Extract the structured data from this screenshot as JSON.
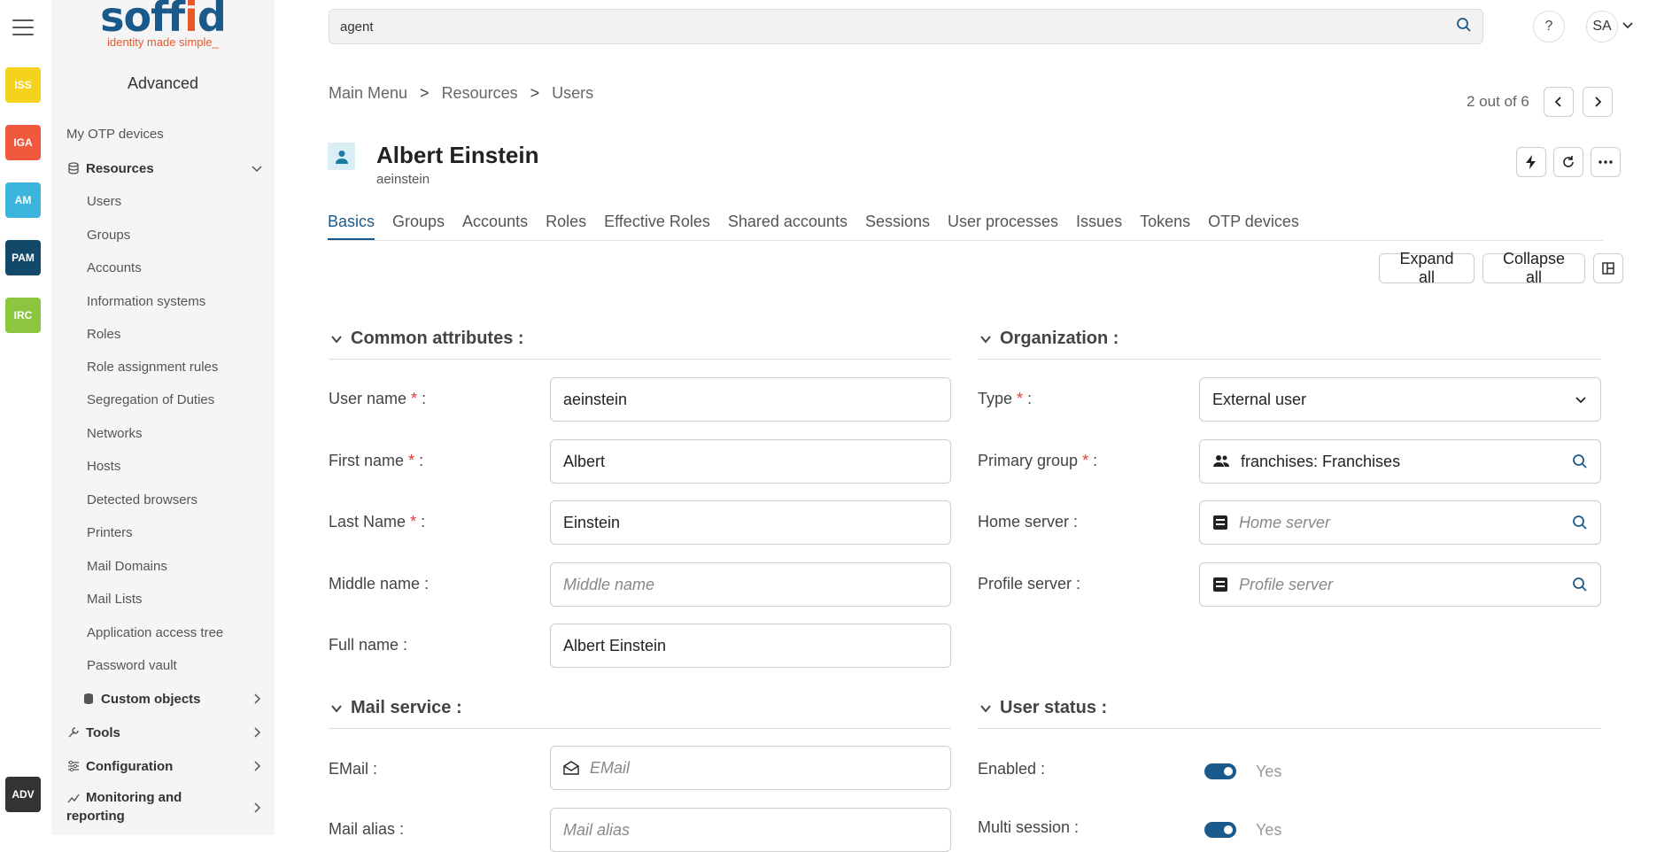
{
  "rail": {
    "items": [
      {
        "label": "ISS",
        "color": "#f5d21b"
      },
      {
        "label": "IGA",
        "color": "#f0593e"
      },
      {
        "label": "AM",
        "color": "#3cb5de"
      },
      {
        "label": "PAM",
        "color": "#12496b"
      },
      {
        "label": "IRC",
        "color": "#8cc63f"
      },
      {
        "label": "ADV",
        "color": "#333333"
      }
    ]
  },
  "logo": {
    "main_a": "soff",
    "main_i": "i",
    "main_b": "d",
    "tagline": "identity made simple_"
  },
  "sidebar": {
    "title": "Advanced",
    "items": [
      {
        "label": "My OTP devices"
      },
      {
        "label": "Resources"
      },
      {
        "label": "Users"
      },
      {
        "label": "Groups"
      },
      {
        "label": "Accounts"
      },
      {
        "label": "Information systems"
      },
      {
        "label": "Roles"
      },
      {
        "label": "Role assignment rules"
      },
      {
        "label": "Segregation of Duties"
      },
      {
        "label": "Networks"
      },
      {
        "label": "Hosts"
      },
      {
        "label": "Detected browsers"
      },
      {
        "label": "Printers"
      },
      {
        "label": "Mail Domains"
      },
      {
        "label": "Mail Lists"
      },
      {
        "label": "Application access tree"
      },
      {
        "label": "Password vault"
      },
      {
        "label": "Custom objects"
      },
      {
        "label": "Tools"
      },
      {
        "label": "Configuration"
      },
      {
        "label": "Monitoring and"
      },
      {
        "label": "reporting"
      }
    ]
  },
  "search": {
    "value": "agent"
  },
  "header": {
    "help": "?",
    "user_initials": "SA"
  },
  "breadcrumb": {
    "items": [
      "Main Menu",
      "Resources",
      "Users"
    ],
    "sep": ">"
  },
  "pager": {
    "text": "2 out of 6"
  },
  "user": {
    "name": "Albert Einstein",
    "login": "aeinstein"
  },
  "tabs": [
    "Basics",
    "Groups",
    "Accounts",
    "Roles",
    "Effective Roles",
    "Shared accounts",
    "Sessions",
    "User processes",
    "Issues",
    "Tokens",
    "OTP devices"
  ],
  "toolbar": {
    "expand": "Expand all",
    "collapse": "Collapse all"
  },
  "common": {
    "title": "Common attributes :",
    "fields": [
      {
        "label": "User name",
        "required": true,
        "value": "aeinstein",
        "placeholder": ""
      },
      {
        "label": "First name",
        "required": true,
        "value": "Albert",
        "placeholder": ""
      },
      {
        "label": "Last Name",
        "required": true,
        "value": "Einstein",
        "placeholder": ""
      },
      {
        "label": "Middle name",
        "required": false,
        "value": "",
        "placeholder": "Middle name"
      },
      {
        "label": "Full name",
        "required": false,
        "value": "Albert Einstein",
        "placeholder": ""
      }
    ]
  },
  "org": {
    "title": "Organization :",
    "type_label": "Type",
    "type_value": "External user",
    "primary_label": "Primary group",
    "primary_value": "franchises: Franchises",
    "home_label": "Home server :",
    "home_placeholder": "Home server",
    "profile_label": "Profile server :",
    "profile_placeholder": "Profile server"
  },
  "mail": {
    "title": "Mail service :",
    "email_label": "EMail :",
    "email_placeholder": "EMail",
    "alias_label": "Mail alias :",
    "alias_placeholder": "Mail alias"
  },
  "status": {
    "title": "User status :",
    "enabled_label": "Enabled :",
    "enabled_value": "Yes",
    "multi_label": "Multi session :",
    "multi_value": "Yes"
  },
  "required_mark": "*",
  "colon": " :"
}
